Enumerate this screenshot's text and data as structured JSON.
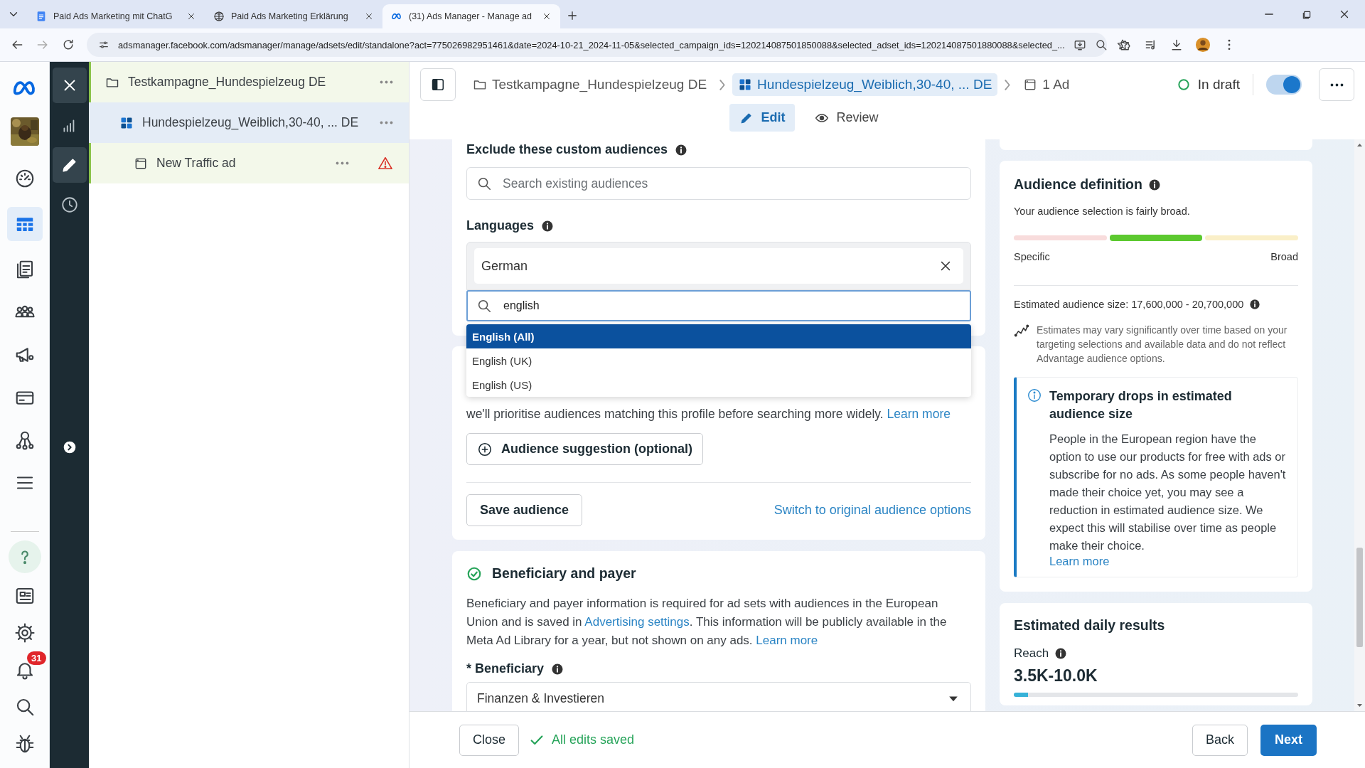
{
  "browser": {
    "tabs": [
      {
        "kind": "doc",
        "title": "Paid Ads Marketing mit ChatG",
        "selected": false
      },
      {
        "kind": "web",
        "title": "Paid Ads Marketing Erklärung",
        "selected": false
      },
      {
        "kind": "meta",
        "title": "(31) Ads Manager - Manage ad",
        "selected": true
      }
    ],
    "url": "adsmanager.facebook.com/adsmanager/manage/adsets/edit/standalone?act=775026982951461&date=2024-10-21_2024-11-05&selected_campaign_ids=120214087501850088&selected_adset_ids=120214087501880088&selected_..."
  },
  "rail": {
    "top": [
      {
        "kind": "dashboard",
        "selected": false
      },
      {
        "kind": "table",
        "selected": true
      },
      {
        "kind": "pages",
        "selected": false
      },
      {
        "kind": "people",
        "selected": false
      },
      {
        "kind": "megaphone",
        "selected": false
      },
      {
        "kind": "card",
        "selected": false
      },
      {
        "kind": "hierarchy",
        "selected": false
      },
      {
        "kind": "menu",
        "selected": false
      }
    ],
    "bottom": [
      {
        "kind": "help"
      },
      {
        "kind": "news"
      },
      {
        "kind": "settings"
      },
      {
        "kind": "bell",
        "badge": "31"
      },
      {
        "kind": "search"
      },
      {
        "kind": "bug"
      }
    ]
  },
  "tool_rail": [
    {
      "kind": "close"
    },
    {
      "kind": "chart",
      "selected": false
    },
    {
      "kind": "edit",
      "selected": true
    },
    {
      "kind": "history",
      "selected": false
    }
  ],
  "tree": [
    {
      "kind": "campaign",
      "label": "Testkampagne_Hundespielzeug DE",
      "selected": false,
      "children": [
        {
          "kind": "adset",
          "label": "Hundespielzeug_Weiblich,30-40, ... DE",
          "selected": true,
          "children": [
            {
              "kind": "ad",
              "label": "New Traffic ad",
              "selected": false,
              "warning": true
            }
          ]
        }
      ]
    }
  ],
  "header": {
    "breadcrumbs": [
      {
        "kind": "campaign",
        "label": "Testkampagne_Hundespielzeug DE",
        "selected": false
      },
      {
        "kind": "adset",
        "label": "Hundespielzeug_Weiblich,30-40, ... DE",
        "selected": true
      },
      {
        "kind": "ad",
        "label": "1 Ad",
        "selected": false
      }
    ],
    "status": "In draft",
    "toggle_on": true,
    "tabs": [
      {
        "kind": "edit",
        "label": "Edit",
        "selected": true
      },
      {
        "kind": "review",
        "label": "Review",
        "selected": false
      }
    ]
  },
  "targeting": {
    "exclude_label": "Exclude these custom audiences",
    "exclude_placeholder": "Search existing audiences",
    "languages_label": "Languages",
    "languages": [
      "German"
    ],
    "language_query": "english",
    "options": [
      {
        "label": "English (All)",
        "selected": true
      },
      {
        "label": "English (UK)",
        "selected": false
      },
      {
        "label": "English (US)",
        "selected": false
      }
    ],
    "suggestion_text": "we'll prioritise audiences matching this profile before searching more widely.",
    "suggestion_link": "Learn more",
    "suggestion_button": "Audience suggestion (optional)",
    "save_button": "Save audience",
    "switch_link": "Switch to original audience options"
  },
  "beneficiary": {
    "title": "Beneficiary and payer",
    "done": true,
    "parts": [
      {
        "kind": "text",
        "text": "Beneficiary and payer information is required for ad sets with audiences in the European Union and is saved in "
      },
      {
        "kind": "link",
        "text": "Advertising settings"
      },
      {
        "kind": "text",
        "text": ". This information will be publicly available in the Meta Ad Library for a year, but not shown on any ads. "
      },
      {
        "kind": "link",
        "text": "Learn more"
      }
    ],
    "field_label": "* Beneficiary",
    "value": "Finanzen & Investieren"
  },
  "audience_definition": {
    "title": "Audience definition",
    "summary": "Your audience selection is fairly broad.",
    "segments": [
      {
        "color": "#f8dcdc",
        "selected": false
      },
      {
        "color": "#5cc92f",
        "selected": true
      },
      {
        "color": "#faefc8",
        "selected": false
      }
    ],
    "scale_start": "Specific",
    "scale_end": "Broad",
    "size": "Estimated audience size: 17,600,000 - 20,700,000",
    "note": "Estimates may vary significantly over time based on your targeting selections and available data and do not reflect Advantage audience options.",
    "notice": {
      "title": "Temporary drops in estimated audience size",
      "body": "People in the European region have the option to use our products for free with ads or subscribe for no ads. As some people haven't made their choice yet, you may see a reduction in estimated audience size. We expect this will stabilise over time as people make their choice.",
      "link": "Learn more"
    }
  },
  "daily_results": {
    "title": "Estimated daily results",
    "metric": "Reach",
    "value": "3.5K-10.0K",
    "level": 0.05
  },
  "footer": {
    "close": "Close",
    "saved": "All edits saved",
    "back": "Back",
    "next": "Next"
  }
}
